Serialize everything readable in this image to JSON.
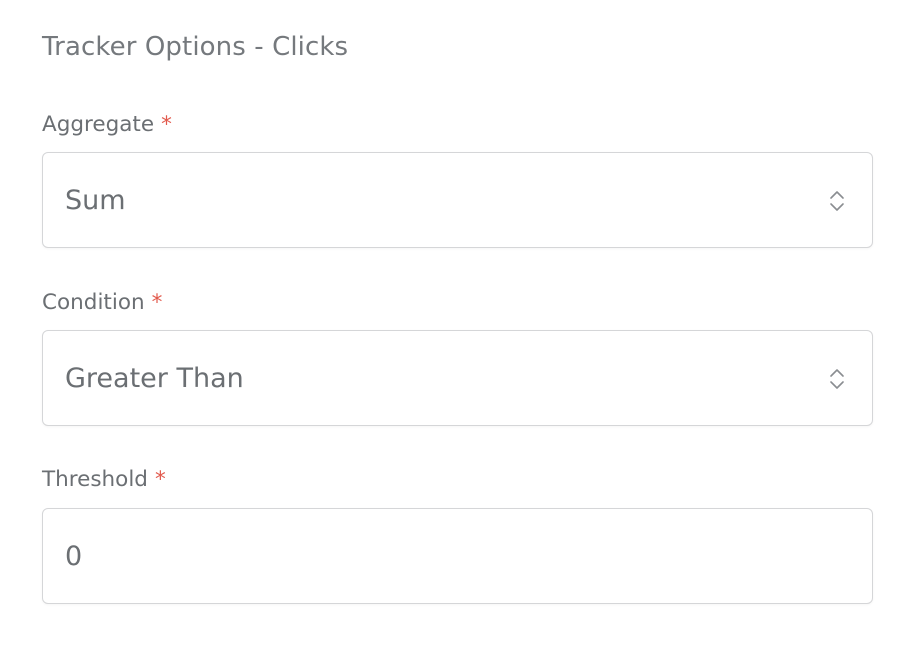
{
  "section": {
    "title": "Tracker Options - Clicks"
  },
  "fields": {
    "aggregate": {
      "label": "Aggregate",
      "required_mark": "*",
      "value": "Sum"
    },
    "condition": {
      "label": "Condition",
      "required_mark": "*",
      "value": "Greater Than"
    },
    "threshold": {
      "label": "Threshold",
      "required_mark": "*",
      "value": "0"
    }
  },
  "icons": {
    "select_indicator": "chevron-up-down-icon"
  },
  "colors": {
    "required": "#e25a4d",
    "text": "#6b6f73",
    "border": "#d5d6d8"
  }
}
